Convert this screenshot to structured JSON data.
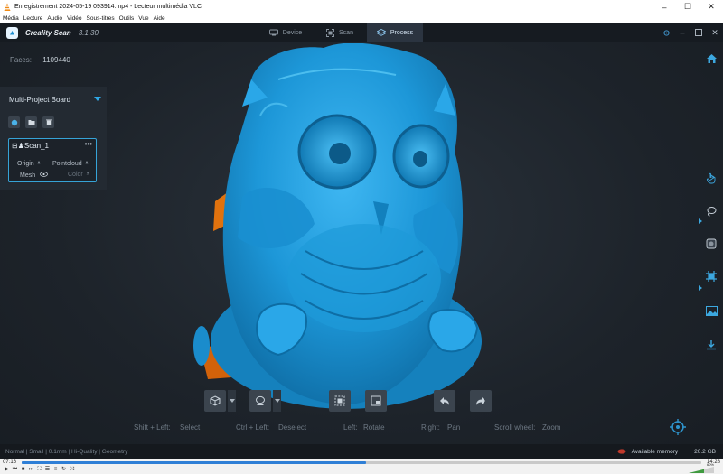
{
  "vlc": {
    "title": "Enregistrement 2024-05-19 093914.mp4 - Lecteur multimédia VLC",
    "menu": [
      "Média",
      "Lecture",
      "Audio",
      "Vidéo",
      "Sous-titres",
      "Outils",
      "Vue",
      "Aide"
    ],
    "time_elapsed": "07:16",
    "time_total": "14:28",
    "progress": 0.506,
    "volume": "60%"
  },
  "app": {
    "name": "Creality Scan",
    "version": "3.1.30",
    "tabs": [
      {
        "label": "Device",
        "icon": "device-icon",
        "active": false
      },
      {
        "label": "Scan",
        "icon": "scan-icon",
        "active": false
      },
      {
        "label": "Process",
        "icon": "layers-icon",
        "active": true
      }
    ],
    "accent": "#2ea8e6"
  },
  "viewport": {
    "faces_label": "Faces:",
    "faces_value": "1109440",
    "model_color": "#1e9ee0"
  },
  "panel": {
    "title": "Multi-Project Board",
    "scan": {
      "name": "Scan_1",
      "origin": "Origin",
      "pointcloud": "Pointcloud",
      "mesh": "Mesh",
      "color": "Color"
    }
  },
  "hints": {
    "shift_left": "Shift + Left:",
    "select": "Select",
    "ctrl_left": "Ctrl + Left:",
    "deselect": "Deselect",
    "left": "Left:",
    "rotate": "Rotate",
    "right": "Right:",
    "pan": "Pan",
    "scroll": "Scroll wheel:",
    "zoom": "Zoom"
  },
  "status": {
    "left": "Normal | Small | 0.1mm | Hi-Quality | Geometry",
    "mem_label": "Available memory",
    "mem_value": "20.2 GB"
  }
}
